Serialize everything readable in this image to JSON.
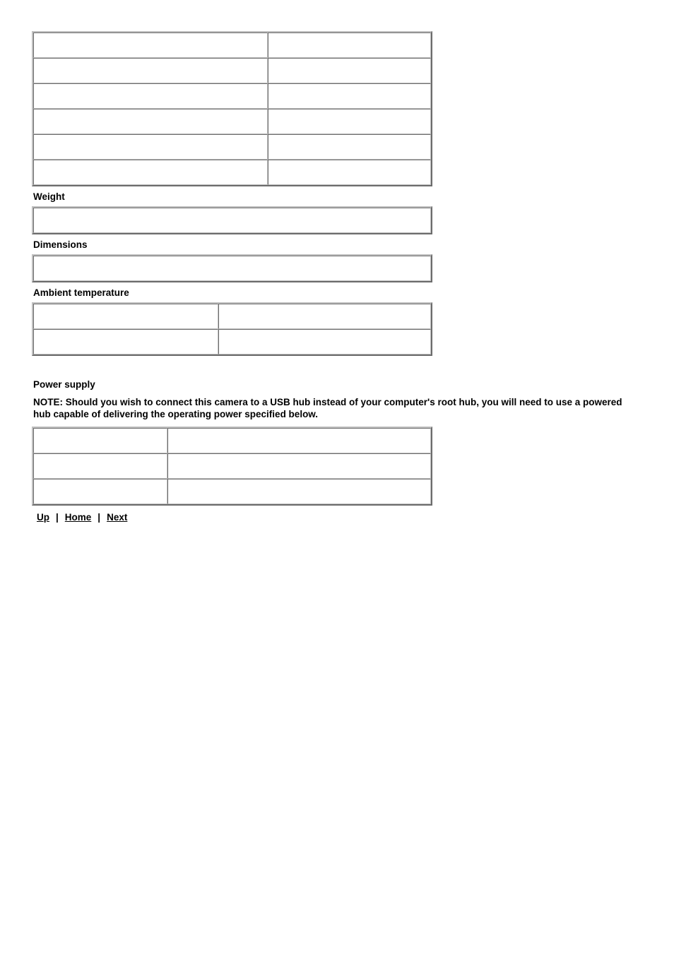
{
  "document": {
    "type": "camera-specification-page",
    "sections": [
      {
        "id": "general-specs",
        "heading": "",
        "table": {
          "columns": 2,
          "column_widths": [
            "332",
            "231"
          ],
          "rows": [
            [
              "",
              ""
            ],
            [
              "",
              ""
            ],
            [
              "",
              ""
            ],
            [
              "",
              ""
            ],
            [
              "",
              ""
            ],
            [
              "",
              ""
            ]
          ]
        }
      },
      {
        "id": "weight",
        "heading": "Weight",
        "table": {
          "columns": 1,
          "column_widths": [
            "563"
          ],
          "rows": [
            [
              ""
            ]
          ]
        }
      },
      {
        "id": "dimensions",
        "heading": "Dimensions",
        "table": {
          "columns": 1,
          "column_widths": [
            "563"
          ],
          "rows": [
            [
              ""
            ]
          ]
        }
      },
      {
        "id": "ambient-temperature",
        "heading": "Ambient temperature",
        "table": {
          "columns": 2,
          "column_widths": [
            "262",
            "301"
          ],
          "rows": [
            [
              "",
              ""
            ],
            [
              "",
              ""
            ]
          ]
        }
      },
      {
        "id": "power-supply",
        "heading": "Power supply",
        "note": "NOTE: Should you wish to connect this camera to a USB hub instead of your computer's root hub, you will need to use a powered hub capable of delivering the operating power specified below.",
        "table": {
          "columns": 2,
          "column_widths": [
            "190",
            "373"
          ],
          "rows": [
            [
              "",
              ""
            ],
            [
              "",
              ""
            ],
            [
              "",
              ""
            ]
          ]
        }
      }
    ]
  },
  "navigation": {
    "up_label": "Up",
    "home_label": "Home",
    "next_label": "Next",
    "separator": "|"
  },
  "colors": {
    "text": "#000000",
    "background": "#ffffff",
    "table_border": "#c0c0c0",
    "link": "#000000"
  }
}
